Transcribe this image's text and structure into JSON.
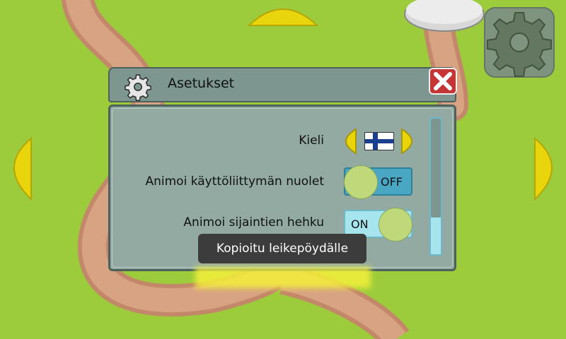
{
  "dialog": {
    "title": "Asetukset"
  },
  "settings": {
    "language_label": "Kieli",
    "animate_arrows_label": "Animoi käyttöliittymän nuolet",
    "animate_arrows_state": "OFF",
    "animate_glow_label": "Animoi sijaintien hehku",
    "animate_glow_state": "ON"
  },
  "toast": {
    "message": "Kopioitu leikepöydälle"
  },
  "icons": {
    "settings_button": "gear-icon",
    "dialog_icon": "gear-icon",
    "close": "close-icon",
    "flag": "finland-flag-icon"
  },
  "colors": {
    "map_green": "#9ccc3b",
    "path_brown": "#c99072",
    "arrow_yellow": "#e8d50c",
    "toggle_off": "#4aa7c4",
    "toggle_on": "#a6e4ee",
    "close_red": "#c63535"
  }
}
